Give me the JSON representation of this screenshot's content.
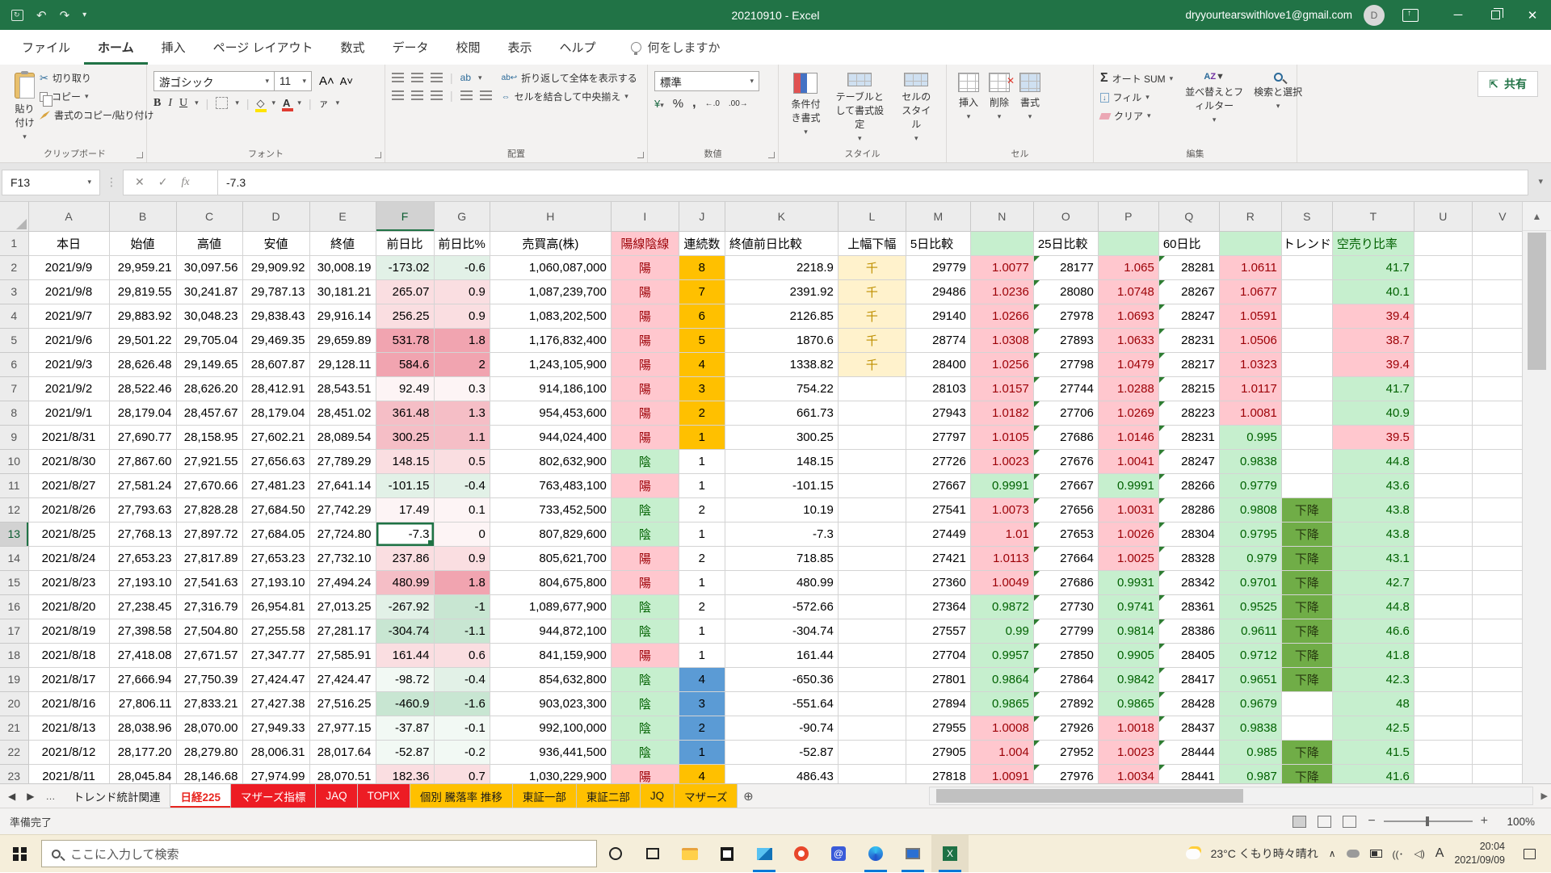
{
  "titlebar": {
    "title": "20210910  -  Excel",
    "account": "dryyourtearswithlove1@gmail.com",
    "avatar_initial": "D"
  },
  "ribbon": {
    "tabs": [
      "ファイル",
      "ホーム",
      "挿入",
      "ページ レイアウト",
      "数式",
      "データ",
      "校閲",
      "表示",
      "ヘルプ"
    ],
    "active_tab": "ホーム",
    "tell_me": "何をしますか",
    "share_label": "共有",
    "clipboard": {
      "label": "クリップボード",
      "paste": "貼り付け",
      "cut": "切り取り",
      "copy": "コピー",
      "format_painter": "書式のコピー/貼り付け"
    },
    "font": {
      "label": "フォント",
      "name": "游ゴシック",
      "size": "11"
    },
    "alignment": {
      "label": "配置",
      "wrap": "折り返して全体を表示する",
      "merge": "セルを結合して中央揃え"
    },
    "number": {
      "label": "数値",
      "format": "標準"
    },
    "styles": {
      "label": "スタイル",
      "conditional": "条件付き書式",
      "table": "テーブルとして書式設定",
      "cell": "セルのスタイル"
    },
    "cells": {
      "label": "セル",
      "insert": "挿入",
      "delete": "削除",
      "format": "書式"
    },
    "editing": {
      "label": "編集",
      "autosum": "オート SUM",
      "fill": "フィル",
      "clear": "クリア",
      "sort": "並べ替えとフィルター",
      "find": "検索と選択"
    }
  },
  "formula_bar": {
    "name_box": "F13",
    "value": "-7.3"
  },
  "sheet": {
    "selected": {
      "ref": "F13",
      "row": 13,
      "col": "F"
    },
    "col_letters": [
      "A",
      "B",
      "C",
      "D",
      "E",
      "F",
      "G",
      "H",
      "I",
      "J",
      "K",
      "L",
      "M",
      "N",
      "O",
      "P",
      "Q",
      "R",
      "S",
      "T",
      "U",
      "V"
    ],
    "header_row": [
      "本日",
      "始値",
      "高値",
      "安値",
      "終値",
      "前日比",
      "前日比%",
      "売買高(株)",
      "陽線陰線",
      "連続数",
      "終値前日比較",
      "上幅下幅",
      "5日比較",
      "",
      "25日比較",
      "",
      "60日比",
      "",
      "トレンド",
      "空売り比率",
      "",
      ""
    ],
    "rows": [
      {
        "n": 2,
        "date": "2021/9/9",
        "open": "29,959.21",
        "high": "30,097.56",
        "low": "29,909.92",
        "close": "30,008.19",
        "change": "-173.02",
        "change_pct": "-0.6",
        "volume": "1,060,087,000",
        "candle": "陽",
        "streak": "8",
        "streak_color": "orange",
        "cum_change": "2218.9",
        "range_note": "千",
        "ma5": "29779",
        "ma5_ratio": "1.0077",
        "ma25": "28177",
        "ma25_ratio": "1.065",
        "ma60": "28281",
        "ma60_ratio": "1.0611",
        "trend": "",
        "short_sell_ratio": "41.7"
      },
      {
        "n": 3,
        "date": "2021/9/8",
        "open": "29,819.55",
        "high": "30,241.87",
        "low": "29,787.13",
        "close": "30,181.21",
        "change": "265.07",
        "change_pct": "0.9",
        "volume": "1,087,239,700",
        "candle": "陽",
        "streak": "7",
        "streak_color": "orange",
        "cum_change": "2391.92",
        "range_note": "千",
        "ma5": "29486",
        "ma5_ratio": "1.0236",
        "ma25": "28080",
        "ma25_ratio": "1.0748",
        "ma60": "28267",
        "ma60_ratio": "1.0677",
        "trend": "",
        "short_sell_ratio": "40.1"
      },
      {
        "n": 4,
        "date": "2021/9/7",
        "open": "29,883.92",
        "high": "30,048.23",
        "low": "29,838.43",
        "close": "29,916.14",
        "change": "256.25",
        "change_pct": "0.9",
        "volume": "1,083,202,500",
        "candle": "陽",
        "streak": "6",
        "streak_color": "orange",
        "cum_change": "2126.85",
        "range_note": "千",
        "ma5": "29140",
        "ma5_ratio": "1.0266",
        "ma25": "27978",
        "ma25_ratio": "1.0693",
        "ma60": "28247",
        "ma60_ratio": "1.0591",
        "trend": "",
        "short_sell_ratio": "39.4"
      },
      {
        "n": 5,
        "date": "2021/9/6",
        "open": "29,501.22",
        "high": "29,705.04",
        "low": "29,469.35",
        "close": "29,659.89",
        "change": "531.78",
        "change_pct": "1.8",
        "volume": "1,176,832,400",
        "candle": "陽",
        "streak": "5",
        "streak_color": "orange",
        "cum_change": "1870.6",
        "range_note": "千",
        "ma5": "28774",
        "ma5_ratio": "1.0308",
        "ma25": "27893",
        "ma25_ratio": "1.0633",
        "ma60": "28231",
        "ma60_ratio": "1.0506",
        "trend": "",
        "short_sell_ratio": "38.7"
      },
      {
        "n": 6,
        "date": "2021/9/3",
        "open": "28,626.48",
        "high": "29,149.65",
        "low": "28,607.87",
        "close": "29,128.11",
        "change": "584.6",
        "change_pct": "2",
        "volume": "1,243,105,900",
        "candle": "陽",
        "streak": "4",
        "streak_color": "orange",
        "cum_change": "1338.82",
        "range_note": "千",
        "ma5": "28400",
        "ma5_ratio": "1.0256",
        "ma25": "27798",
        "ma25_ratio": "1.0479",
        "ma60": "28217",
        "ma60_ratio": "1.0323",
        "trend": "",
        "short_sell_ratio": "39.4"
      },
      {
        "n": 7,
        "date": "2021/9/2",
        "open": "28,522.46",
        "high": "28,626.20",
        "low": "28,412.91",
        "close": "28,543.51",
        "change": "92.49",
        "change_pct": "0.3",
        "volume": "914,186,100",
        "candle": "陽",
        "streak": "3",
        "streak_color": "orange",
        "cum_change": "754.22",
        "range_note": "",
        "ma5": "28103",
        "ma5_ratio": "1.0157",
        "ma25": "27744",
        "ma25_ratio": "1.0288",
        "ma60": "28215",
        "ma60_ratio": "1.0117",
        "trend": "",
        "short_sell_ratio": "41.7"
      },
      {
        "n": 8,
        "date": "2021/9/1",
        "open": "28,179.04",
        "high": "28,457.67",
        "low": "28,179.04",
        "close": "28,451.02",
        "change": "361.48",
        "change_pct": "1.3",
        "volume": "954,453,600",
        "candle": "陽",
        "streak": "2",
        "streak_color": "orange",
        "cum_change": "661.73",
        "range_note": "",
        "ma5": "27943",
        "ma5_ratio": "1.0182",
        "ma25": "27706",
        "ma25_ratio": "1.0269",
        "ma60": "28223",
        "ma60_ratio": "1.0081",
        "trend": "",
        "short_sell_ratio": "40.9"
      },
      {
        "n": 9,
        "date": "2021/8/31",
        "open": "27,690.77",
        "high": "28,158.95",
        "low": "27,602.21",
        "close": "28,089.54",
        "change": "300.25",
        "change_pct": "1.1",
        "volume": "944,024,400",
        "candle": "陽",
        "streak": "1",
        "streak_color": "orange",
        "cum_change": "300.25",
        "range_note": "",
        "ma5": "27797",
        "ma5_ratio": "1.0105",
        "ma25": "27686",
        "ma25_ratio": "1.0146",
        "ma60": "28231",
        "ma60_ratio": "0.995",
        "trend": "",
        "short_sell_ratio": "39.5"
      },
      {
        "n": 10,
        "date": "2021/8/30",
        "open": "27,867.60",
        "high": "27,921.55",
        "low": "27,656.63",
        "close": "27,789.29",
        "change": "148.15",
        "change_pct": "0.5",
        "volume": "802,632,900",
        "candle": "陰",
        "streak": "1",
        "streak_color": "white",
        "cum_change": "148.15",
        "range_note": "",
        "ma5": "27726",
        "ma5_ratio": "1.0023",
        "ma25": "27676",
        "ma25_ratio": "1.0041",
        "ma60": "28247",
        "ma60_ratio": "0.9838",
        "trend": "",
        "short_sell_ratio": "44.8"
      },
      {
        "n": 11,
        "date": "2021/8/27",
        "open": "27,581.24",
        "high": "27,670.66",
        "low": "27,481.23",
        "close": "27,641.14",
        "change": "-101.15",
        "change_pct": "-0.4",
        "volume": "763,483,100",
        "candle": "陽",
        "streak": "1",
        "streak_color": "white",
        "cum_change": "-101.15",
        "range_note": "",
        "ma5": "27667",
        "ma5_ratio": "0.9991",
        "ma25": "27667",
        "ma25_ratio": "0.9991",
        "ma60": "28266",
        "ma60_ratio": "0.9779",
        "trend": "",
        "short_sell_ratio": "43.6"
      },
      {
        "n": 12,
        "date": "2021/8/26",
        "open": "27,793.63",
        "high": "27,828.28",
        "low": "27,684.50",
        "close": "27,742.29",
        "change": "17.49",
        "change_pct": "0.1",
        "volume": "733,452,500",
        "candle": "陰",
        "streak": "2",
        "streak_color": "white",
        "cum_change": "10.19",
        "range_note": "",
        "ma5": "27541",
        "ma5_ratio": "1.0073",
        "ma25": "27656",
        "ma25_ratio": "1.0031",
        "ma60": "28286",
        "ma60_ratio": "0.9808",
        "trend": "下降",
        "short_sell_ratio": "43.8"
      },
      {
        "n": 13,
        "date": "2021/8/25",
        "open": "27,768.13",
        "high": "27,897.72",
        "low": "27,684.05",
        "close": "27,724.80",
        "change": "-7.3",
        "change_pct": "0",
        "volume": "807,829,600",
        "candle": "陰",
        "streak": "1",
        "streak_color": "white",
        "cum_change": "-7.3",
        "range_note": "",
        "ma5": "27449",
        "ma5_ratio": "1.01",
        "ma25": "27653",
        "ma25_ratio": "1.0026",
        "ma60": "28304",
        "ma60_ratio": "0.9795",
        "trend": "下降",
        "short_sell_ratio": "43.8"
      },
      {
        "n": 14,
        "date": "2021/8/24",
        "open": "27,653.23",
        "high": "27,817.89",
        "low": "27,653.23",
        "close": "27,732.10",
        "change": "237.86",
        "change_pct": "0.9",
        "volume": "805,621,700",
        "candle": "陽",
        "streak": "2",
        "streak_color": "white",
        "cum_change": "718.85",
        "range_note": "",
        "ma5": "27421",
        "ma5_ratio": "1.0113",
        "ma25": "27664",
        "ma25_ratio": "1.0025",
        "ma60": "28328",
        "ma60_ratio": "0.979",
        "trend": "下降",
        "short_sell_ratio": "43.1"
      },
      {
        "n": 15,
        "date": "2021/8/23",
        "open": "27,193.10",
        "high": "27,541.63",
        "low": "27,193.10",
        "close": "27,494.24",
        "change": "480.99",
        "change_pct": "1.8",
        "volume": "804,675,800",
        "candle": "陽",
        "streak": "1",
        "streak_color": "white",
        "cum_change": "480.99",
        "range_note": "",
        "ma5": "27360",
        "ma5_ratio": "1.0049",
        "ma25": "27686",
        "ma25_ratio": "0.9931",
        "ma60": "28342",
        "ma60_ratio": "0.9701",
        "trend": "下降",
        "short_sell_ratio": "42.7"
      },
      {
        "n": 16,
        "date": "2021/8/20",
        "open": "27,238.45",
        "high": "27,316.79",
        "low": "26,954.81",
        "close": "27,013.25",
        "change": "-267.92",
        "change_pct": "-1",
        "volume": "1,089,677,900",
        "candle": "陰",
        "streak": "2",
        "streak_color": "white",
        "cum_change": "-572.66",
        "range_note": "",
        "ma5": "27364",
        "ma5_ratio": "0.9872",
        "ma25": "27730",
        "ma25_ratio": "0.9741",
        "ma60": "28361",
        "ma60_ratio": "0.9525",
        "trend": "下降",
        "short_sell_ratio": "44.8"
      },
      {
        "n": 17,
        "date": "2021/8/19",
        "open": "27,398.58",
        "high": "27,504.80",
        "low": "27,255.58",
        "close": "27,281.17",
        "change": "-304.74",
        "change_pct": "-1.1",
        "volume": "944,872,100",
        "candle": "陰",
        "streak": "1",
        "streak_color": "white",
        "cum_change": "-304.74",
        "range_note": "",
        "ma5": "27557",
        "ma5_ratio": "0.99",
        "ma25": "27799",
        "ma25_ratio": "0.9814",
        "ma60": "28386",
        "ma60_ratio": "0.9611",
        "trend": "下降",
        "short_sell_ratio": "46.6"
      },
      {
        "n": 18,
        "date": "2021/8/18",
        "open": "27,418.08",
        "high": "27,671.57",
        "low": "27,347.77",
        "close": "27,585.91",
        "change": "161.44",
        "change_pct": "0.6",
        "volume": "841,159,900",
        "candle": "陽",
        "streak": "1",
        "streak_color": "white",
        "cum_change": "161.44",
        "range_note": "",
        "ma5": "27704",
        "ma5_ratio": "0.9957",
        "ma25": "27850",
        "ma25_ratio": "0.9905",
        "ma60": "28405",
        "ma60_ratio": "0.9712",
        "trend": "下降",
        "short_sell_ratio": "41.8"
      },
      {
        "n": 19,
        "date": "2021/8/17",
        "open": "27,666.94",
        "high": "27,750.39",
        "low": "27,424.47",
        "close": "27,424.47",
        "change": "-98.72",
        "change_pct": "-0.4",
        "volume": "854,632,800",
        "candle": "陰",
        "streak": "4",
        "streak_color": "blue",
        "cum_change": "-650.36",
        "range_note": "",
        "ma5": "27801",
        "ma5_ratio": "0.9864",
        "ma25": "27864",
        "ma25_ratio": "0.9842",
        "ma60": "28417",
        "ma60_ratio": "0.9651",
        "trend": "下降",
        "short_sell_ratio": "42.3"
      },
      {
        "n": 20,
        "date": "2021/8/16",
        "open": "27,806.11",
        "high": "27,833.21",
        "low": "27,427.38",
        "close": "27,516.25",
        "change": "-460.9",
        "change_pct": "-1.6",
        "volume": "903,023,300",
        "candle": "陰",
        "streak": "3",
        "streak_color": "blue",
        "cum_change": "-551.64",
        "range_note": "",
        "ma5": "27894",
        "ma5_ratio": "0.9865",
        "ma25": "27892",
        "ma25_ratio": "0.9865",
        "ma60": "28428",
        "ma60_ratio": "0.9679",
        "trend": "",
        "short_sell_ratio": "48"
      },
      {
        "n": 21,
        "date": "2021/8/13",
        "open": "28,038.96",
        "high": "28,070.00",
        "low": "27,949.33",
        "close": "27,977.15",
        "change": "-37.87",
        "change_pct": "-0.1",
        "volume": "992,100,000",
        "candle": "陰",
        "streak": "2",
        "streak_color": "blue",
        "cum_change": "-90.74",
        "range_note": "",
        "ma5": "27955",
        "ma5_ratio": "1.0008",
        "ma25": "27926",
        "ma25_ratio": "1.0018",
        "ma60": "28437",
        "ma60_ratio": "0.9838",
        "trend": "",
        "short_sell_ratio": "42.5"
      },
      {
        "n": 22,
        "date": "2021/8/12",
        "open": "28,177.20",
        "high": "28,279.80",
        "low": "28,006.31",
        "close": "28,017.64",
        "change": "-52.87",
        "change_pct": "-0.2",
        "volume": "936,441,500",
        "candle": "陰",
        "streak": "1",
        "streak_color": "blue",
        "cum_change": "-52.87",
        "range_note": "",
        "ma5": "27905",
        "ma5_ratio": "1.004",
        "ma25": "27952",
        "ma25_ratio": "1.0023",
        "ma60": "28444",
        "ma60_ratio": "0.985",
        "trend": "下降",
        "short_sell_ratio": "41.5"
      },
      {
        "n": 23,
        "date": "2021/8/11",
        "open": "28,045.84",
        "high": "28,146.68",
        "low": "27,974.99",
        "close": "28,070.51",
        "change": "182.36",
        "change_pct": "0.7",
        "volume": "1,030,229,900",
        "candle": "陽",
        "streak": "4",
        "streak_color": "orange",
        "cum_change": "486.43",
        "range_note": "",
        "ma5": "27818",
        "ma5_ratio": "1.0091",
        "ma25": "27976",
        "ma25_ratio": "1.0034",
        "ma60": "28441",
        "ma60_ratio": "0.987",
        "trend": "下降",
        "short_sell_ratio": "41.6"
      }
    ]
  },
  "sheet_tabs": [
    {
      "label": "トレンド統計関連",
      "type": "plain"
    },
    {
      "label": "日経225",
      "type": "active"
    },
    {
      "label": "マザーズ指標",
      "type": "red"
    },
    {
      "label": "JAQ",
      "type": "red"
    },
    {
      "label": "TOPIX",
      "type": "red"
    },
    {
      "label": "個別 騰落率 推移",
      "type": "orange"
    },
    {
      "label": "東証一部",
      "type": "orange"
    },
    {
      "label": "東証二部",
      "type": "orange"
    },
    {
      "label": "JQ",
      "type": "orange"
    },
    {
      "label": "マザーズ",
      "type": "orange"
    }
  ],
  "status_bar": {
    "ready": "準備完了",
    "zoom": "100%"
  },
  "taskbar": {
    "search_placeholder": "ここに入力して検索",
    "weather": "23°C くもり時々晴れ",
    "ime": "A",
    "time": "20:04",
    "date": "2021/09/09"
  }
}
